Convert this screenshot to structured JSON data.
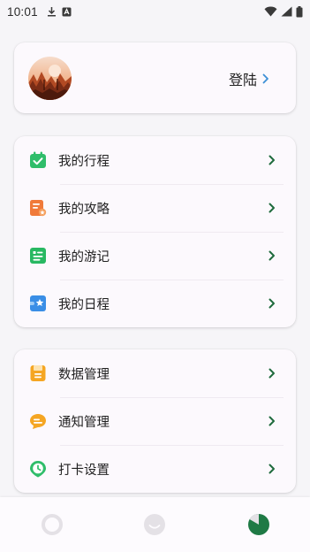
{
  "status_bar": {
    "time": "10:01"
  },
  "profile": {
    "login_label": "登陆"
  },
  "menu_group_1": [
    {
      "label": "我的行程",
      "icon": "calendar-check-icon",
      "color": "#2fbd6a"
    },
    {
      "label": "我的攻略",
      "icon": "guide-doc-icon",
      "color": "#f07a3a"
    },
    {
      "label": "我的游记",
      "icon": "travel-notes-icon",
      "color": "#28b862"
    },
    {
      "label": "我的日程",
      "icon": "schedule-puzzle-icon",
      "color": "#3a8ee6"
    }
  ],
  "menu_group_2": [
    {
      "label": "数据管理",
      "icon": "data-folder-icon",
      "color": "#f5a623"
    },
    {
      "label": "通知管理",
      "icon": "notification-chat-icon",
      "color": "#f5a623"
    },
    {
      "label": "打卡设置",
      "icon": "clock-pin-icon",
      "color": "#2fbd6a"
    }
  ],
  "colors": {
    "arrow": "#1f6b3d",
    "nav_active": "#1f7a45",
    "nav_inactive": "#e4e1e6"
  }
}
